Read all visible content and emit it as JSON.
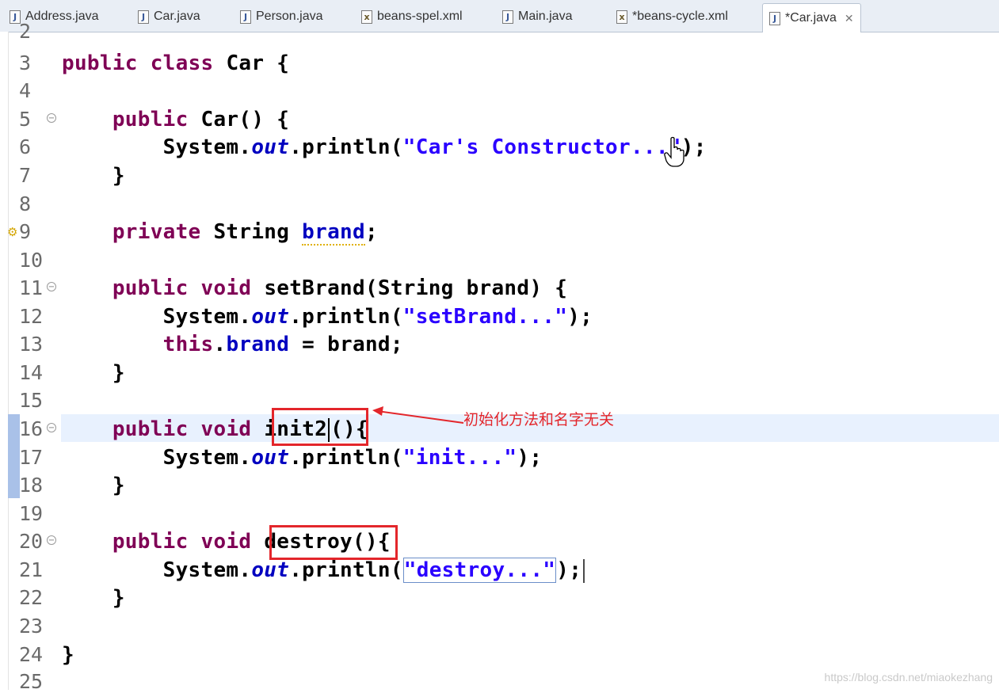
{
  "tabs": [
    {
      "label": "Address.java",
      "type": "java"
    },
    {
      "label": "Car.java",
      "type": "java"
    },
    {
      "label": "Person.java",
      "type": "java"
    },
    {
      "label": "beans-spel.xml",
      "type": "xml"
    },
    {
      "label": "Main.java",
      "type": "java"
    },
    {
      "label": "*beans-cycle.xml",
      "type": "xml"
    },
    {
      "label": "*Car.java",
      "type": "java",
      "active": true
    }
  ],
  "editor": {
    "line_numbers": [
      "2",
      "3",
      "4",
      "5",
      "6",
      "7",
      "8",
      "9",
      "10",
      "11",
      "12",
      "13",
      "14",
      "15",
      "16",
      "17",
      "18",
      "19",
      "20",
      "21",
      "22",
      "23",
      "24",
      "25"
    ],
    "tokens": {
      "public": "public",
      "class": "class",
      "private": "private",
      "void": "void",
      "this": "this",
      "car_decl": " Car {",
      "ctor": " Car() {",
      "sysout": "System.",
      "out": "out",
      "println_open": ".println(",
      "ctor_str": "\"Car's Constructor...\"",
      "close_stmt": ");",
      "close_brace": "}",
      "string_type": " String ",
      "brand": "brand",
      "semicolon": ";",
      "setbrand_sig": " setBrand(String brand) {",
      "setbrand_str": "\"setBrand...\"",
      "assign": " = brand;",
      "init_name": "init2",
      "parens": "()",
      "open_brace": "{",
      "init_str": "\"init...\"",
      "destroy_name": "destroy()",
      "destroy_str": "\"destroy...\""
    }
  },
  "annotation": {
    "text": "初始化方法和名字无关",
    "color": "#e3262b"
  },
  "watermark": "https://blog.csdn.net/miaokezhang",
  "colors": {
    "keyword": "#7f0055",
    "string": "#2a00ff",
    "field": "#0000c0",
    "current_line": "#e8f1fe"
  }
}
